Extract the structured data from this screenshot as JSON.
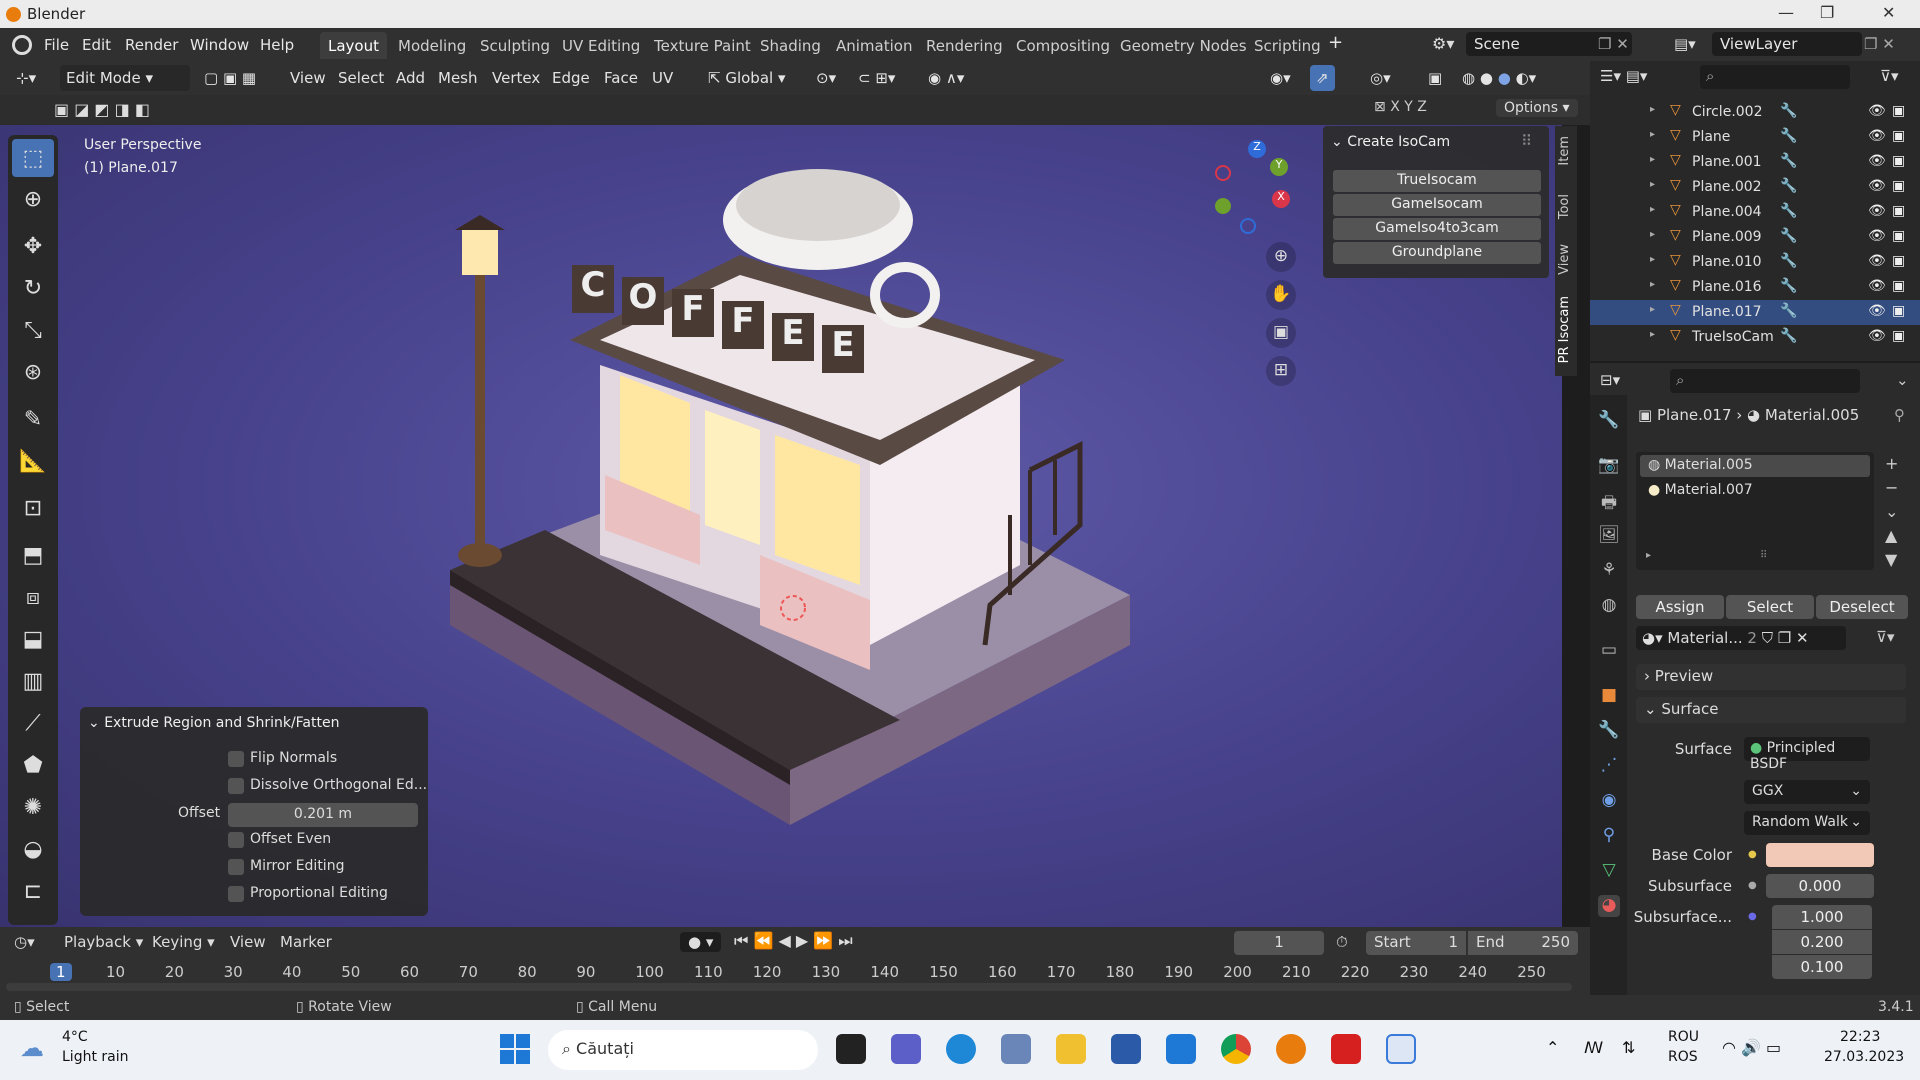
{
  "window": {
    "title": "Blender"
  },
  "menu": [
    "File",
    "Edit",
    "Render",
    "Window",
    "Help"
  ],
  "workspaces": [
    "Layout",
    "Modeling",
    "Sculpting",
    "UV Editing",
    "Texture Paint",
    "Shading",
    "Animation",
    "Rendering",
    "Compositing",
    "Geometry Nodes",
    "Scripting"
  ],
  "scene": {
    "name": "Scene",
    "view_layer": "ViewLayer"
  },
  "header": {
    "mode": "Edit Mode",
    "menus": [
      "View",
      "Select",
      "Add",
      "Mesh",
      "Vertex",
      "Edge",
      "Face",
      "UV"
    ],
    "orientation": "Global",
    "options": "Options"
  },
  "viewport": {
    "perspective": "User Perspective",
    "object": "(1) Plane.017",
    "axes": [
      "X",
      "Y",
      "Z"
    ],
    "sign_letters": [
      "C",
      "O",
      "F",
      "F",
      "E",
      "E"
    ]
  },
  "npanel": {
    "title": "Create IsoCam",
    "buttons": [
      "TrueIsocam",
      "GameIsocam",
      "GameIso4to3cam",
      "Groundplane"
    ],
    "tabs": [
      "Item",
      "Tool",
      "View",
      "PR Isocam"
    ]
  },
  "operator": {
    "title": "Extrude Region and Shrink/Fatten",
    "flip_normals": "Flip Normals",
    "dissolve": "Dissolve Orthogonal Ed...",
    "offset_label": "Offset",
    "offset_value": "0.201 m",
    "offset_even": "Offset Even",
    "mirror": "Mirror Editing",
    "proportional": "Proportional Editing"
  },
  "outliner": {
    "items": [
      {
        "name": "Circle.002"
      },
      {
        "name": "Plane"
      },
      {
        "name": "Plane.001"
      },
      {
        "name": "Plane.002"
      },
      {
        "name": "Plane.004"
      },
      {
        "name": "Plane.009"
      },
      {
        "name": "Plane.010"
      },
      {
        "name": "Plane.016"
      },
      {
        "name": "Plane.017"
      },
      {
        "name": "TrueIsoCam"
      }
    ]
  },
  "properties": {
    "breadcrumb_object": "Plane.017",
    "breadcrumb_material": "Material.005",
    "slots": [
      "Material.005",
      "Material.007"
    ],
    "assign": "Assign",
    "select": "Select",
    "deselect": "Deselect",
    "material_name": "Material...",
    "material_users": "2",
    "preview": "Preview",
    "surface_section": "Surface",
    "surface_label": "Surface",
    "surface_value": "Principled BSDF",
    "distribution": "GGX",
    "subsurface_method": "Random Walk",
    "base_color_label": "Base Color",
    "base_color": "#f2c9b6",
    "subsurface_label": "Subsurface",
    "subsurface_value": "0.000",
    "subsurface_radius_label": "Subsurface...",
    "radius": [
      "1.000",
      "0.200",
      "0.100"
    ]
  },
  "timeline": {
    "menus": [
      "Playback",
      "Keying",
      "View",
      "Marker"
    ],
    "current": "1",
    "start_label": "Start",
    "start": "1",
    "end_label": "End",
    "end": "250",
    "ticks": [
      "1",
      "10",
      "20",
      "30",
      "40",
      "50",
      "60",
      "70",
      "80",
      "90",
      "100",
      "110",
      "120",
      "130",
      "140",
      "150",
      "160",
      "170",
      "180",
      "190",
      "200",
      "210",
      "220",
      "230",
      "240",
      "250"
    ]
  },
  "status": {
    "select": "Select",
    "rotate": "Rotate View",
    "call_menu": "Call Menu",
    "version": "3.4.1"
  },
  "taskbar": {
    "temp": "4°C",
    "weather": "Light rain",
    "search": "Căutați",
    "lang1": "ROU",
    "lang2": "ROS",
    "time": "22:23",
    "date": "27.03.2023"
  }
}
